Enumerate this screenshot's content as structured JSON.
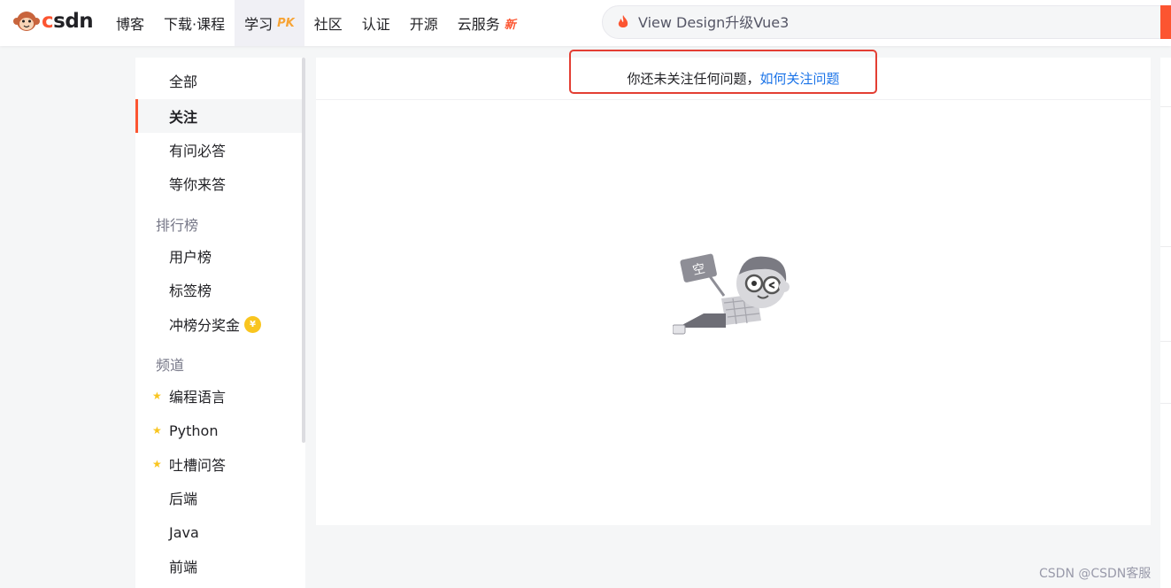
{
  "header": {
    "logo_text": "CSDN",
    "nav": [
      {
        "label": "博客"
      },
      {
        "label": "下载·课程"
      },
      {
        "label": "学习",
        "badge": "PK"
      },
      {
        "label": "社区"
      },
      {
        "label": "认证"
      },
      {
        "label": "开源"
      },
      {
        "label": "云服务",
        "badge": "新"
      }
    ],
    "search_placeholder": "View Design升级Vue3"
  },
  "sidebar": {
    "items_top": [
      "全部",
      "关注",
      "有问必答",
      "等你来答"
    ],
    "rank_header": "排行榜",
    "rank_items": [
      "用户榜",
      "标签榜",
      "冲榜分奖金"
    ],
    "channel_header": "频道",
    "channel_items": [
      "编程语言",
      "Python",
      "吐槽问答",
      "后端",
      "Java",
      "前端"
    ],
    "active": "关注"
  },
  "main": {
    "notice_text": "你还未关注任何问题，",
    "notice_link": "如何关注问题",
    "empty_sign": "空"
  },
  "watermark": "CSDN @CSDN客服",
  "colors": {
    "accent": "#fc5531",
    "link": "#1a73e8",
    "highlight": "#e33e33",
    "star": "#f9c51f"
  }
}
